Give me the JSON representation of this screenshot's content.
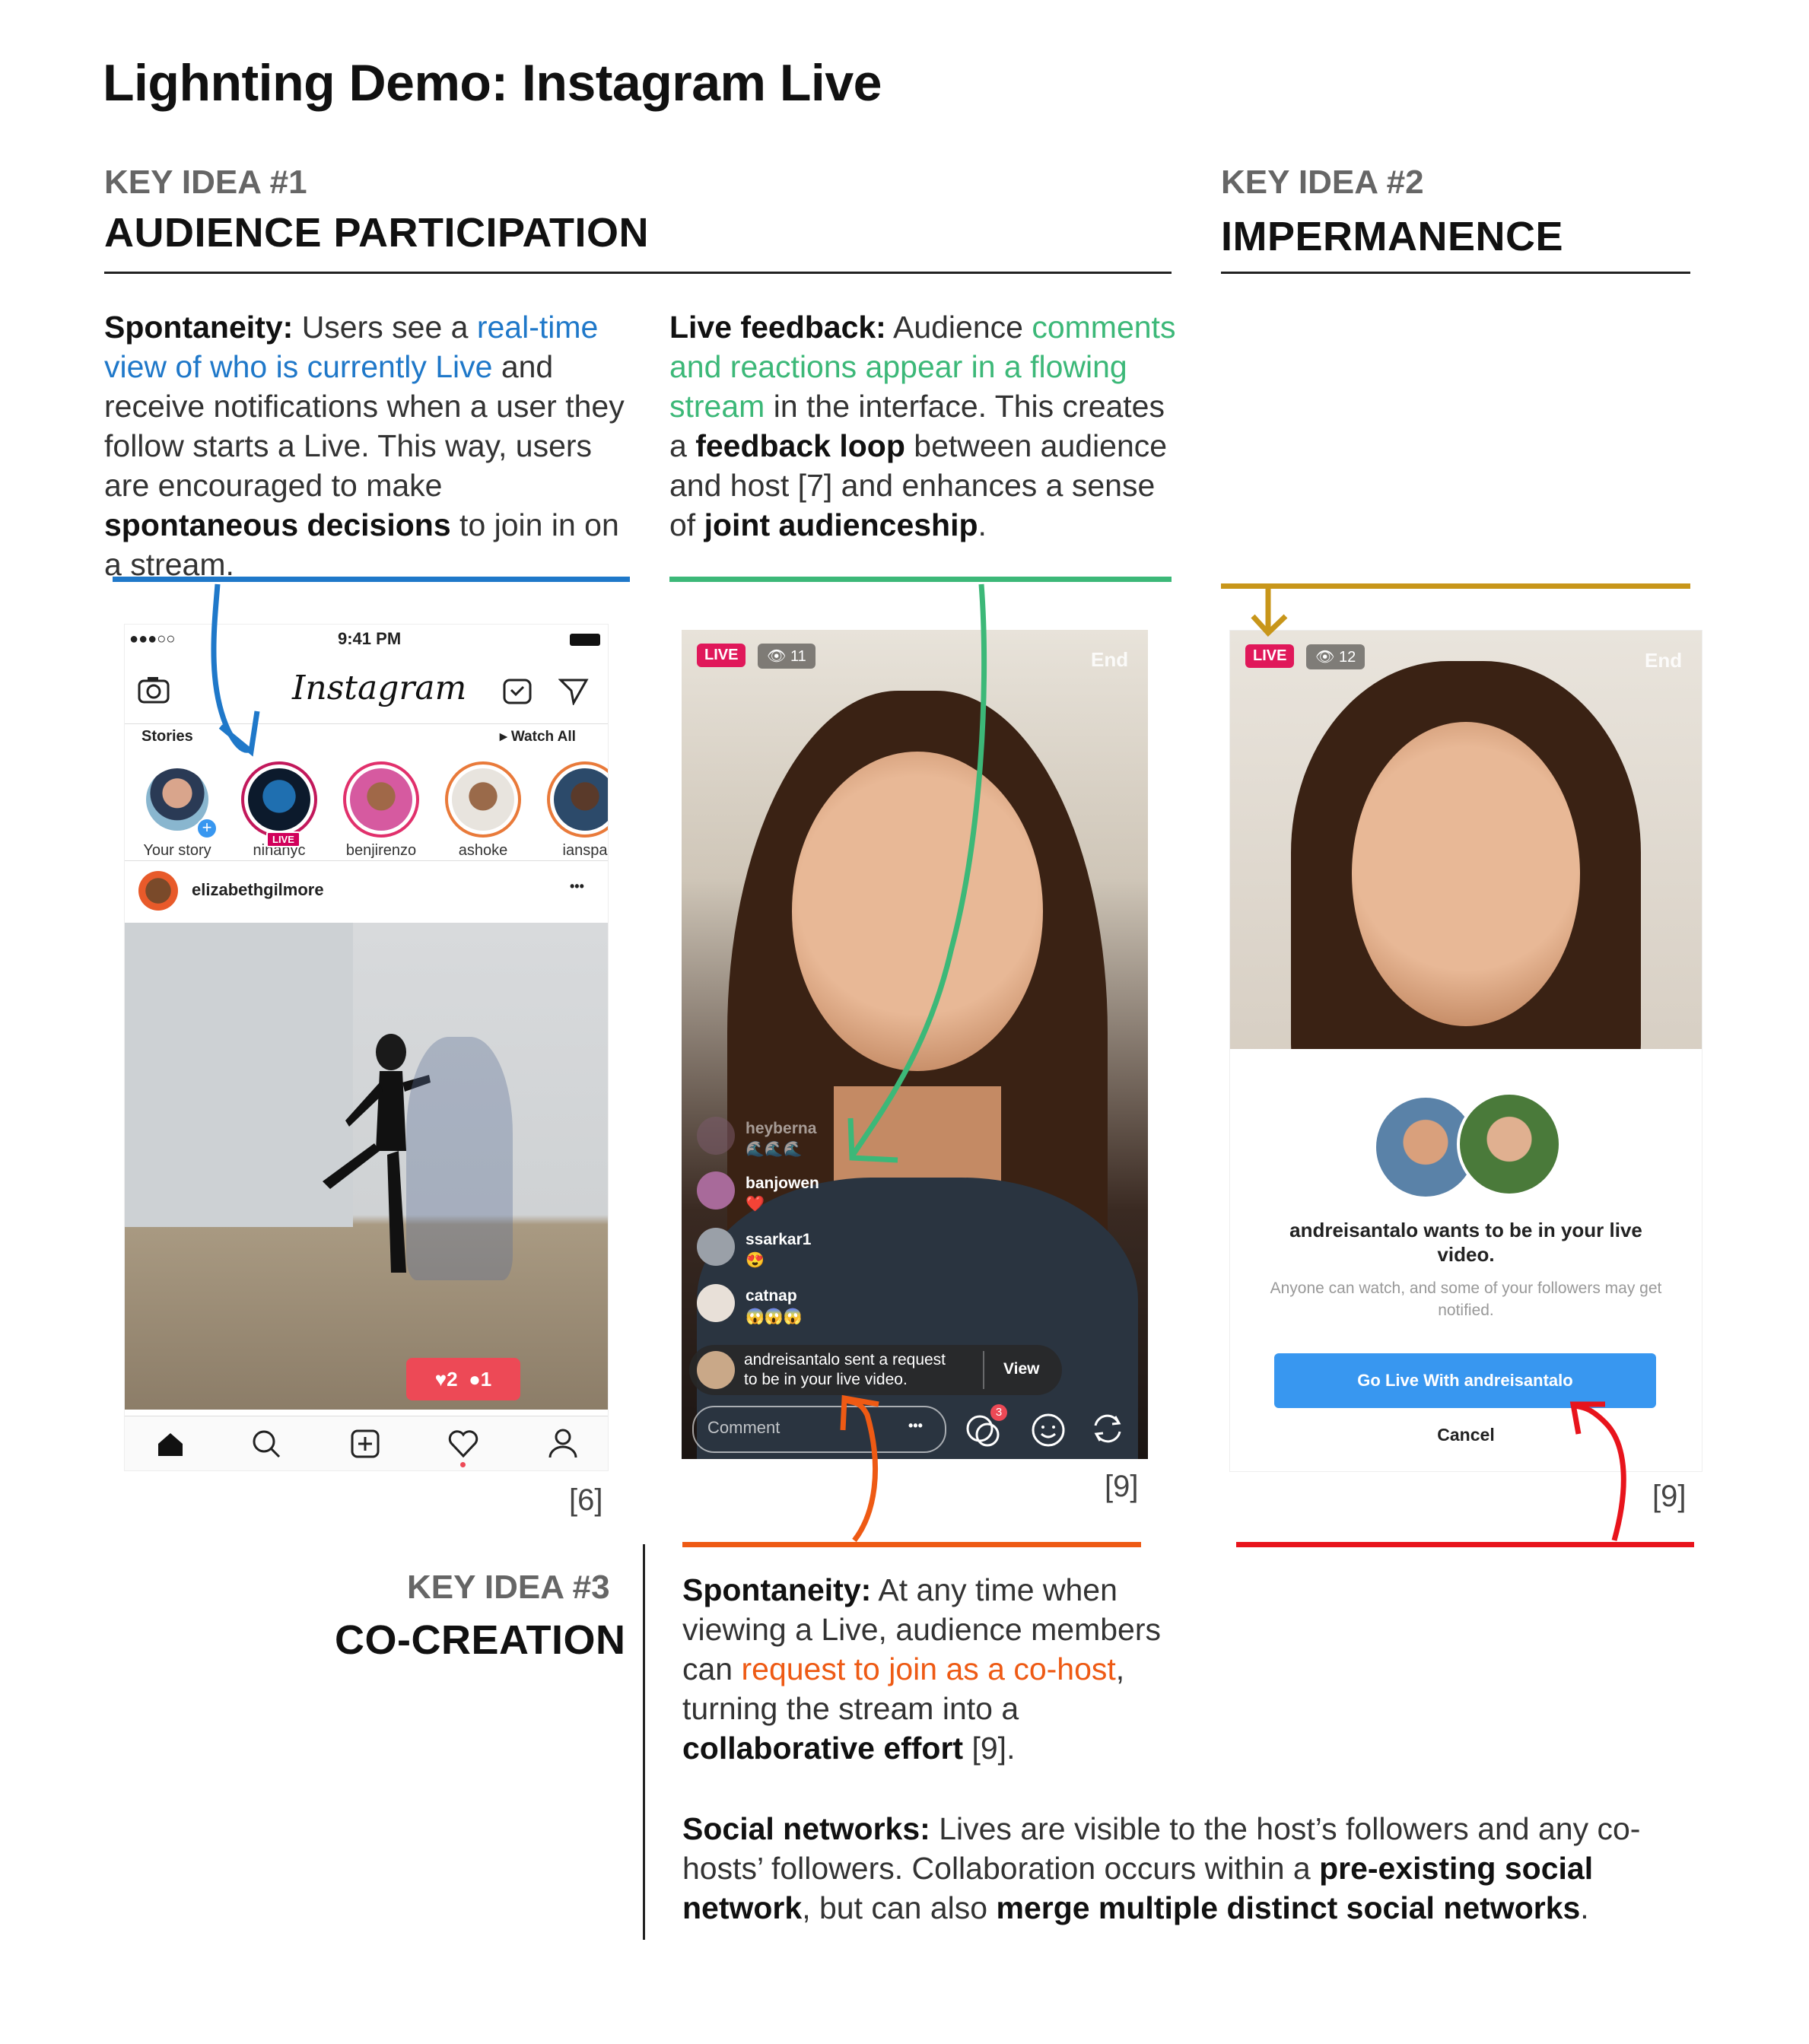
{
  "title": "Lighnting Demo: Instagram Live",
  "key_ideas": [
    {
      "label": "KEY IDEA #1",
      "name": "AUDIENCE PARTICIPATION"
    },
    {
      "label": "KEY IDEA #2",
      "name": "IMPERMANENCE"
    },
    {
      "label": "KEY IDEA #3",
      "name": "CO-CREATION"
    }
  ],
  "paragraphs": {
    "p1": {
      "lead": "Spontaneity:",
      "t1": " Users see a ",
      "hl": "real-time view of who is currently Live",
      "t2": " and receive notifications when a user they follow starts a Live. This way, users are encouraged to make ",
      "b1": "spontaneous decisions",
      "t3": " to join in on a stream."
    },
    "p2": {
      "lead": "Live feedback:",
      "t1": " Audience ",
      "hl": "comments and reactions appear in a flowing stream",
      "t2": " in the interface. This creates a ",
      "b1": "feedback loop",
      "t3": " between audience and host [7] and enhances a sense of ",
      "b2": "joint audienceship",
      "t4": "."
    },
    "p3": {
      "lead": "Spontaneity:",
      "t1": " At any time when viewing a Live, audience members can ",
      "hl": "request to join as a co-host",
      "t2": ", turning the stream into a ",
      "b1": "collaborative effort",
      "t3": " [9]."
    },
    "p4": {
      "lead": "Social networks:",
      "t1": " Lives are visible to the host’s followers and any co-hosts’ followers. Collaboration occurs within a ",
      "b1": "pre-existing social network",
      "t2": ", but can also ",
      "b2": "merge multiple distinct social networks",
      "t3": "."
    }
  },
  "citations": {
    "c1": "[6]",
    "c2": "[9]",
    "c3": "[9]"
  },
  "colors": {
    "blue": "#1f78c9",
    "green": "#3cb878",
    "gold": "#c8961a",
    "orange": "#ee5a14",
    "red": "#e8141c"
  },
  "phone1": {
    "time": "9:41 PM",
    "logo": "Instagram",
    "stories_label": "Stories",
    "watch_all": "▸ Watch All",
    "stories": [
      {
        "name": "Your story"
      },
      {
        "name": "ninanyc",
        "badge": "LIVE"
      },
      {
        "name": "benjirenzo"
      },
      {
        "name": "ashoke"
      },
      {
        "name": "ianspa"
      }
    ],
    "post_user": "elizabethgilmore",
    "post_more": "•••",
    "likes": "♥2",
    "comments": "●1"
  },
  "phone2": {
    "live_badge": "LIVE",
    "viewers": "👁 11",
    "end": "End",
    "comments": [
      {
        "user": "heyberna",
        "emoji": "🌊🌊🌊"
      },
      {
        "user": "banjowen",
        "emoji": "❤️"
      },
      {
        "user": "ssarkar1",
        "emoji": "😍"
      },
      {
        "user": "catnap",
        "emoji": "😱😱😱"
      }
    ],
    "request_text_1": "andreisantalo sent a request",
    "request_text_2": "to be in your live video.",
    "view": "View",
    "comment_placeholder": "Comment",
    "more": "•••",
    "notif_count": "3"
  },
  "phone3": {
    "live_badge": "LIVE",
    "viewers": "👁 12",
    "end": "End",
    "request_title": "andreisantalo wants to be in your live video.",
    "request_sub": "Anyone can watch, and some of your followers may get notified.",
    "go_live": "Go Live With andreisantalo",
    "cancel": "Cancel"
  }
}
